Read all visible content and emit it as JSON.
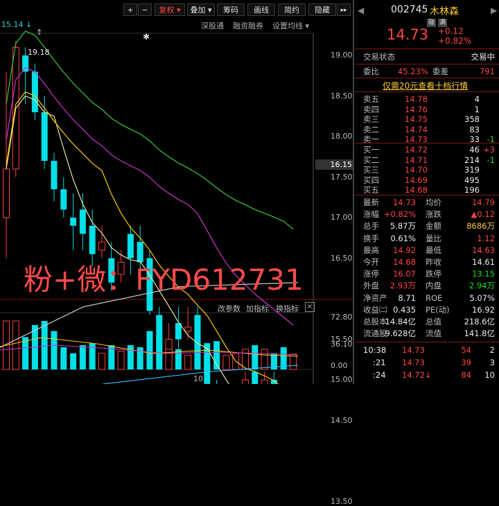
{
  "toolbar": {
    "plus": "+",
    "minus": "−",
    "fuquan": "复权",
    "diejia": "叠加",
    "chouma": "筹码",
    "huaxian": "画线",
    "jianyue": "简约",
    "yincang": "隐藏",
    "more": "▸▸"
  },
  "chart_header": {
    "left_value": "15.14",
    "links": [
      "深股通",
      "融资融券",
      "设置均线"
    ]
  },
  "chart_data": {
    "type": "candlestick",
    "y_ticks": [
      "19.00",
      "18.50",
      "18.00",
      "17.50",
      "17.00",
      "16.50",
      "15.50",
      "15.00",
      "14.50",
      "13.50"
    ],
    "price_label": "16.15",
    "high_annotation": "19.18",
    "candles": [
      {
        "o": 17.0,
        "c": 17.6,
        "h": 18.8,
        "l": 16.5
      },
      {
        "o": 17.6,
        "c": 19.1,
        "h": 19.18,
        "l": 17.5
      },
      {
        "o": 19.0,
        "c": 18.8,
        "h": 19.1,
        "l": 18.4
      },
      {
        "o": 18.8,
        "c": 18.3,
        "h": 18.9,
        "l": 18.2
      },
      {
        "o": 18.3,
        "c": 17.7,
        "h": 18.5,
        "l": 17.6
      },
      {
        "o": 17.7,
        "c": 17.35,
        "h": 17.8,
        "l": 17.2
      },
      {
        "o": 17.35,
        "c": 17.1,
        "h": 17.5,
        "l": 17.0
      },
      {
        "o": 17.0,
        "c": 16.9,
        "h": 17.3,
        "l": 16.6
      },
      {
        "o": 17.1,
        "c": 16.8,
        "h": 17.3,
        "l": 16.6
      },
      {
        "o": 16.9,
        "c": 16.55,
        "h": 17.1,
        "l": 16.4
      },
      {
        "o": 16.6,
        "c": 16.7,
        "h": 16.9,
        "l": 16.5
      },
      {
        "o": 16.5,
        "c": 16.2,
        "h": 16.7,
        "l": 16.1
      },
      {
        "o": 16.3,
        "c": 16.45,
        "h": 16.6,
        "l": 16.2
      },
      {
        "o": 16.8,
        "c": 16.5,
        "h": 16.9,
        "l": 16.3
      },
      {
        "o": 16.7,
        "c": 16.45,
        "h": 16.9,
        "l": 16.3
      },
      {
        "o": 16.5,
        "c": 15.85,
        "h": 16.6,
        "l": 15.8
      },
      {
        "o": 15.8,
        "c": 15.25,
        "h": 15.9,
        "l": 15.2
      },
      {
        "o": 15.3,
        "c": 15.5,
        "h": 15.7,
        "l": 15.2
      },
      {
        "o": 15.7,
        "c": 15.5,
        "h": 15.9,
        "l": 15.3
      },
      {
        "o": 15.6,
        "c": 15.65,
        "h": 15.9,
        "l": 15.5
      },
      {
        "o": 15.8,
        "c": 15.35,
        "h": 15.9,
        "l": 15.2
      },
      {
        "o": 15.3,
        "c": 14.95,
        "h": 15.4,
        "l": 14.8
      },
      {
        "o": 14.9,
        "c": 14.5,
        "h": 15.0,
        "l": 14.4
      },
      {
        "o": 14.5,
        "c": 14.55,
        "h": 14.7,
        "l": 14.4
      },
      {
        "o": 14.6,
        "c": 14.7,
        "h": 14.8,
        "l": 14.5
      },
      {
        "o": 14.8,
        "c": 15.0,
        "h": 15.1,
        "l": 14.7
      },
      {
        "o": 15.1,
        "c": 14.8,
        "h": 15.2,
        "l": 14.7
      },
      {
        "o": 14.8,
        "c": 15.0,
        "h": 15.1,
        "l": 14.75
      },
      {
        "o": 15.0,
        "c": 14.9,
        "h": 15.1,
        "l": 14.8
      },
      {
        "o": 14.9,
        "c": 14.65,
        "h": 14.95,
        "l": 14.6
      },
      {
        "o": 14.65,
        "c": 14.73,
        "h": 14.92,
        "l": 14.63
      }
    ],
    "volume_ticks": [
      "72.80",
      "36.10",
      "0.00"
    ],
    "x_label": "10",
    "indicator_buttons": [
      "改参数",
      "加指标",
      "换指标"
    ]
  },
  "watermark": "粉+微：FYD612731",
  "stock": {
    "code": "002745",
    "name": "木林森",
    "badges": [
      "融",
      "满"
    ],
    "price": "14.73",
    "change": "+0.12",
    "change_pct": "+0.82%",
    "status_label": "交易状态",
    "status_value": "交易中",
    "weibi_label": "委比",
    "weibi_value": "45.23%",
    "weicha_label": "委差",
    "weicha_value": "791",
    "promo": "仅需20元查看十档行情"
  },
  "asks": [
    {
      "label": "卖五",
      "price": "14.78",
      "vol": "4",
      "chg": ""
    },
    {
      "label": "卖四",
      "price": "14.76",
      "vol": "1",
      "chg": ""
    },
    {
      "label": "卖三",
      "price": "14.75",
      "vol": "358",
      "chg": ""
    },
    {
      "label": "卖二",
      "price": "14.74",
      "vol": "83",
      "chg": ""
    },
    {
      "label": "卖一",
      "price": "14.73",
      "vol": "33",
      "chg": "-1"
    }
  ],
  "bids": [
    {
      "label": "买一",
      "price": "14.72",
      "vol": "46",
      "chg": "+3"
    },
    {
      "label": "买二",
      "price": "14.71",
      "vol": "214",
      "chg": "-1"
    },
    {
      "label": "买三",
      "price": "14.70",
      "vol": "319",
      "chg": ""
    },
    {
      "label": "买四",
      "price": "14.69",
      "vol": "495",
      "chg": ""
    },
    {
      "label": "买五",
      "price": "14.68",
      "vol": "196",
      "chg": ""
    }
  ],
  "stats": [
    {
      "l1": "最新",
      "v1": "14.73",
      "c1": "red",
      "l2": "均价",
      "v2": "14.79",
      "c2": "red"
    },
    {
      "l1": "涨幅",
      "v1": "+0.82%",
      "c1": "red",
      "l2": "涨跌",
      "v2": "▲0.12",
      "c2": "red"
    },
    {
      "l1": "总手",
      "v1": "5.87万",
      "c1": "white",
      "l2": "金额",
      "v2": "8686万",
      "c2": "yel"
    },
    {
      "l1": "换手",
      "v1": "0.61%",
      "c1": "white",
      "l2": "量比",
      "v2": "1.12",
      "c2": "red"
    },
    {
      "l1": "最高",
      "v1": "14.92",
      "c1": "red",
      "l2": "最低",
      "v2": "14.63",
      "c2": "red"
    },
    {
      "l1": "今开",
      "v1": "14.68",
      "c1": "red",
      "l2": "昨收",
      "v2": "14.61",
      "c2": "white"
    },
    {
      "l1": "涨停",
      "v1": "16.07",
      "c1": "red",
      "l2": "跌停",
      "v2": "13.15",
      "c2": "green"
    },
    {
      "l1": "外盘",
      "v1": "2.93万",
      "c1": "red",
      "l2": "内盘",
      "v2": "2.94万",
      "c2": "green"
    },
    {
      "l1": "净资产",
      "v1": "8.71",
      "c1": "white",
      "l2": "ROE",
      "v2": "5.07%",
      "c2": "white"
    },
    {
      "l1": "收益㈡",
      "v1": "0.435",
      "c1": "white",
      "l2": "PE(动)",
      "v2": "16.92",
      "c2": "white"
    },
    {
      "l1": "总股本",
      "v1": "14.84亿",
      "c1": "white",
      "l2": "总值",
      "v2": "218.6亿",
      "c2": "white"
    },
    {
      "l1": "流通股",
      "v1": "9.628亿",
      "c1": "white",
      "l2": "流值",
      "v2": "141.8亿",
      "c2": "white"
    }
  ],
  "ticks": [
    {
      "time": "10:38",
      "price": "14.73",
      "vol": "54",
      "n": "2"
    },
    {
      "time": ":21",
      "price": "14.73",
      "vol": "39",
      "n": "3"
    },
    {
      "time": ":24",
      "price": "14.72↓",
      "vol": "84",
      "n": "10"
    }
  ]
}
